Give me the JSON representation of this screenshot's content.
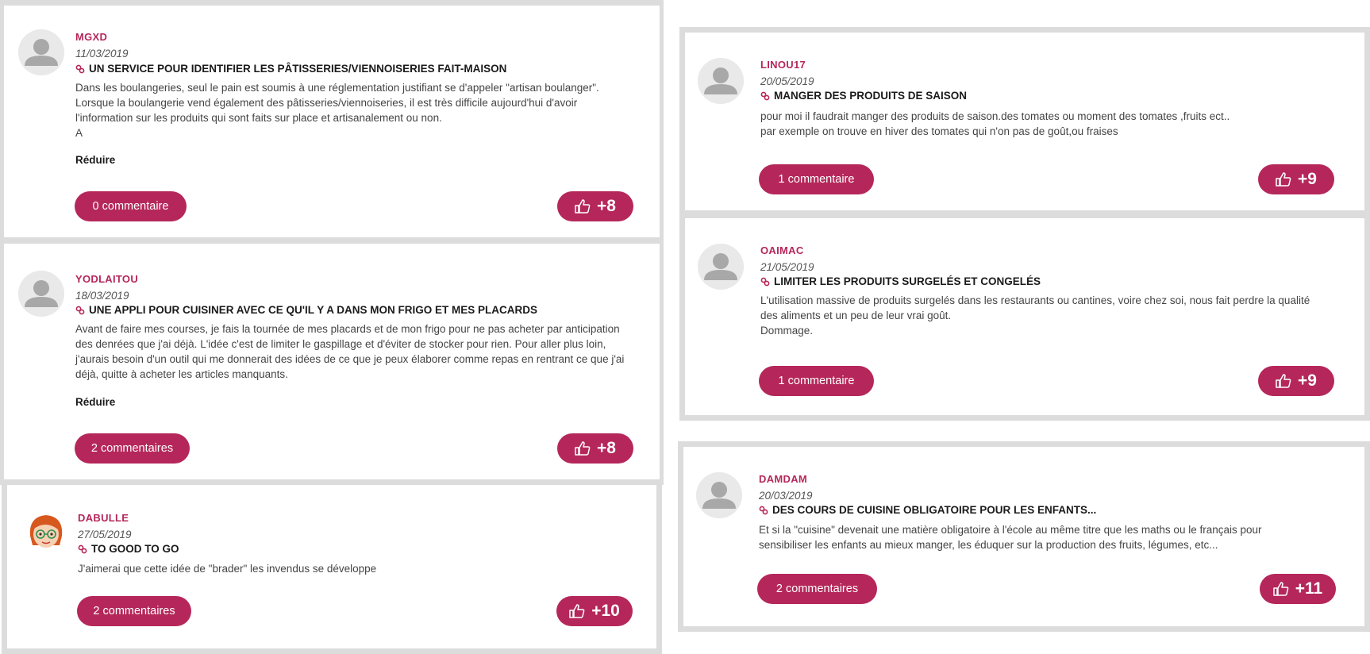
{
  "colors": {
    "accent": "#b5275a",
    "border": "#dcdcdc"
  },
  "cards": [
    {
      "author": "MGXD",
      "date": "11/03/2019",
      "title": "UN SERVICE POUR IDENTIFIER LES PÂTISSERIES/VIENNOISERIES FAIT-MAISON",
      "body": [
        "Dans les boulangeries, seul le pain est soumis à une réglementation justifiant se d'appeler \"artisan boulanger\".",
        "Lorsque la boulangerie vend également des pâtisseries/viennoiseries, il est très difficile aujourd'hui d'avoir",
        "l'information sur les produits qui sont faits sur place et artisanalement ou non.",
        "A"
      ],
      "reduce": "Réduire",
      "comments": "0 commentaire",
      "likes": "+8"
    },
    {
      "author": "YODLAITOU",
      "date": "18/03/2019",
      "title": "UNE APPLI POUR CUISINER AVEC CE QU'IL Y A DANS MON FRIGO ET MES PLACARDS",
      "body": [
        "Avant de faire mes courses, je fais la tournée de mes placards et de mon frigo pour ne pas acheter par anticipation",
        "des denrées que j'ai déjà. L'idée c'est de limiter le gaspillage et d'éviter de stocker pour rien. Pour aller plus loin,",
        "j'aurais besoin d'un outil qui me donnerait des idées de ce que je peux élaborer comme repas en rentrant ce que j'ai",
        "déjà, quitte à acheter les articles manquants."
      ],
      "reduce": "Réduire",
      "comments": "2 commentaires",
      "likes": "+8"
    },
    {
      "author": "DABULLE",
      "date": "27/05/2019",
      "title": "TO GOOD TO GO",
      "body": [
        "J'aimerai que cette idée de \"brader\" les invendus se développe"
      ],
      "comments": "2 commentaires",
      "likes": "+10"
    },
    {
      "author": "LINOU17",
      "date": "20/05/2019",
      "title": "MANGER DES PRODUITS DE SAISON",
      "body": [
        "pour moi il faudrait manger des produits de saison.des tomates ou moment des tomates ,fruits ect..",
        "par exemple on trouve en hiver des tomates qui n'on pas de goût,ou fraises"
      ],
      "comments": "1 commentaire",
      "likes": "+9"
    },
    {
      "author": "OAIMAC",
      "date": "21/05/2019",
      "title": "LIMITER LES PRODUITS SURGELÉS ET CONGELÉS",
      "body": [
        "L'utilisation massive de produits surgelés dans les restaurants ou cantines, voire chez soi, nous fait perdre la qualité",
        "des aliments et un peu de leur vrai goût.",
        "Dommage."
      ],
      "comments": "1 commentaire",
      "likes": "+9"
    },
    {
      "author": "DAMDAM",
      "date": "20/03/2019",
      "title": "DES COURS DE CUISINE OBLIGATOIRE POUR LES ENFANTS...",
      "body": [
        "Et si la \"cuisine\" devenait une matière obligatoire à l'école au même titre que les maths ou le français pour",
        "sensibiliser les enfants au mieux manger, les éduquer sur la production des fruits, légumes, etc..."
      ],
      "comments": "2 commentaires",
      "likes": "+11"
    }
  ]
}
